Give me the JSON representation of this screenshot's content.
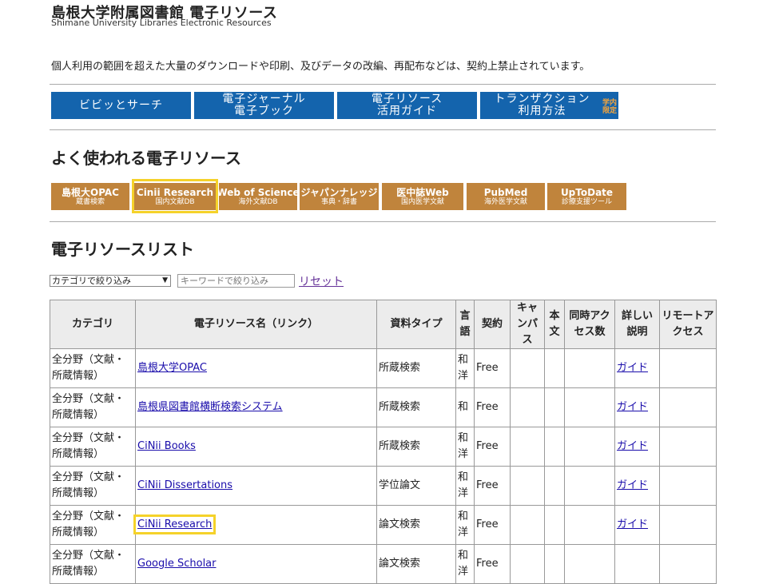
{
  "header": {
    "title": "島根大学附属図書館 電子リソース",
    "subtitle": "Shimane University Libraries Electronic Resources"
  },
  "notice": "個人利用の範囲を超えた大量のダウンロードや印刷、及びデータの改編、再配布などは、契約上禁止されています。",
  "nav": [
    {
      "line1": "ビビッとサーチ",
      "line2": ""
    },
    {
      "line1": "電子ジャーナル",
      "line2": "電子ブック"
    },
    {
      "line1": "電子リソース",
      "line2": "活用ガイド"
    },
    {
      "line1": "トランザクション",
      "line2": "利用方法",
      "tag1": "学内",
      "tag2": "限定"
    }
  ],
  "popular": {
    "heading": "よく使われる電子リソース",
    "items": [
      {
        "main": "島根大OPAC",
        "sub": "蔵書検索"
      },
      {
        "main": "Cinii Research",
        "sub": "国内文献DB"
      },
      {
        "main": "Web of Science",
        "sub": "海外文献DB"
      },
      {
        "main": "ジャパンナレッジ",
        "sub": "事典・辞書"
      },
      {
        "main": "医中誌Web",
        "sub": "国内医学文献"
      },
      {
        "main": "PubMed",
        "sub": "海外医学文献"
      },
      {
        "main": "UpToDate",
        "sub": "診療支援ツール"
      }
    ]
  },
  "list": {
    "heading": "電子リソースリスト",
    "category_select": "カテゴリで絞り込み",
    "keyword_placeholder": "キーワードで絞り込み",
    "reset": "リセット"
  },
  "table": {
    "headers": {
      "category": "カテゴリ",
      "name": "電子リソース名（リンク）",
      "type": "資料タイプ",
      "lang": "言語",
      "contract": "契約",
      "campus": "キャンパス",
      "fulltext": "本文",
      "concurrent": "同時アクセス数",
      "detail": "詳しい説明",
      "remote": "リモートアクセス"
    },
    "rows": [
      {
        "category": "全分野（文献・所蔵情報）",
        "name": "島根大学OPAC",
        "type": "所蔵検索",
        "lang": "和洋",
        "contract": "Free",
        "detail": "ガイド"
      },
      {
        "category": "全分野（文献・所蔵情報）",
        "name": "島根県図書館横断検索システム",
        "type": "所蔵検索",
        "lang": "和",
        "contract": "Free",
        "detail": "ガイド"
      },
      {
        "category": "全分野（文献・所蔵情報）",
        "name": "CiNii Books",
        "type": "所蔵検索",
        "lang": "和洋",
        "contract": "Free",
        "detail": "ガイド"
      },
      {
        "category": "全分野（文献・所蔵情報）",
        "name": "CiNii Dissertations",
        "type": "学位論文",
        "lang": "和洋",
        "contract": "Free",
        "detail": "ガイド"
      },
      {
        "category": "全分野（文献・所蔵情報）",
        "name": "CiNii Research",
        "type": "論文検索",
        "lang": "和洋",
        "contract": "Free",
        "detail": "ガイド"
      },
      {
        "category": "全分野（文献・所蔵情報）",
        "name": "Google Scholar",
        "type": "論文検索",
        "lang": "和洋",
        "contract": "Free",
        "detail": ""
      }
    ]
  }
}
